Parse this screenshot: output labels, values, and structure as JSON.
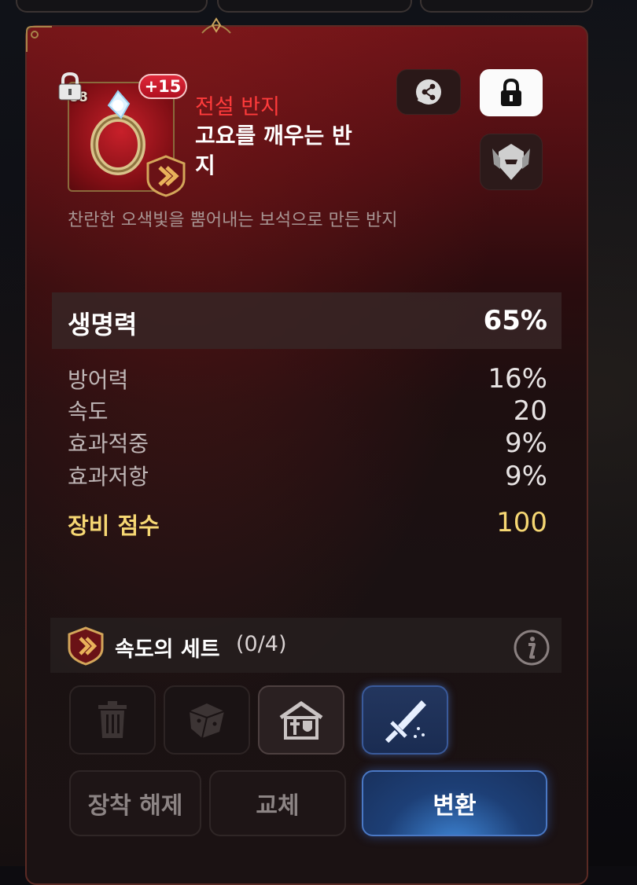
{
  "item": {
    "level": "88",
    "enhance": "+15",
    "rarity": "전설 반지",
    "name": "고요를 깨우는 반지",
    "description": "찬란한 오색빛을 뿜어내는 보석으로 만든 반지",
    "icon": "ring-icon"
  },
  "header_buttons": {
    "share_icon": "share-icon",
    "lock_icon": "lock-icon",
    "helmet_icon": "helmet-icon"
  },
  "main_stat": {
    "name": "생명력",
    "value": "65%"
  },
  "sub_stats": [
    {
      "name": "방어력",
      "value": "16%"
    },
    {
      "name": "속도",
      "value": "20"
    },
    {
      "name": "효과적중",
      "value": "9%"
    },
    {
      "name": "효과저항",
      "value": "9%"
    }
  ],
  "gear_score": {
    "name": "장비 점수",
    "value": "100"
  },
  "set": {
    "name": "속도의 세트",
    "count": "(0/4)",
    "icon": "speed-set-icon",
    "info_icon": "info-icon"
  },
  "action_icons": [
    "trash-icon",
    "dice-icon",
    "armory-icon",
    "sword-icon"
  ],
  "buttons": {
    "unequip": "장착 해제",
    "replace": "교체",
    "convert": "변환"
  },
  "colors": {
    "rarity": "#ff3b3b",
    "score": "#f6d773",
    "accent_blue": "#1d3f76",
    "panel_red": "#6d1418"
  }
}
